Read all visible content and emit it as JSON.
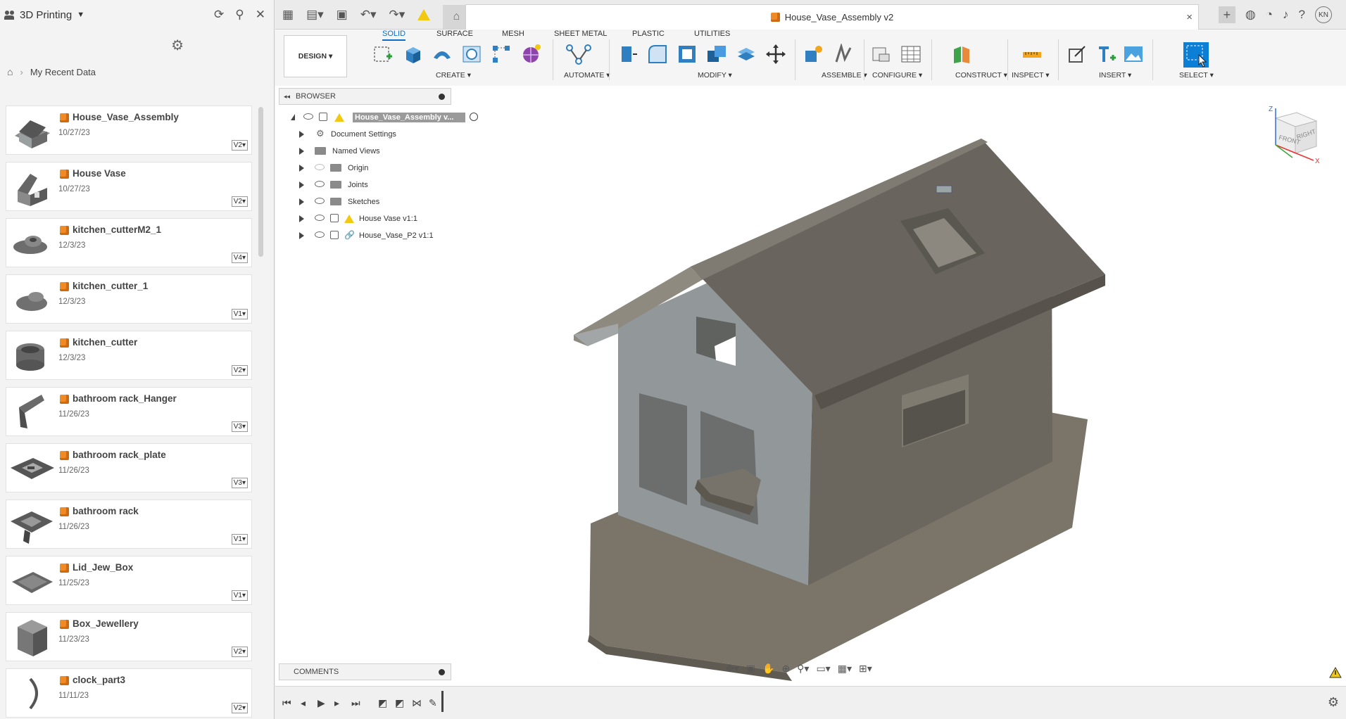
{
  "left_panel": {
    "project_title": "3D Printing",
    "breadcrumb": "My Recent Data",
    "files": [
      {
        "name": "House_Vase_Assembly",
        "date": "10/27/23",
        "version": "V2▾"
      },
      {
        "name": "House Vase",
        "date": "10/27/23",
        "version": "V2▾"
      },
      {
        "name": "kitchen_cutterM2_1",
        "date": "12/3/23",
        "version": "V4▾"
      },
      {
        "name": "kitchen_cutter_1",
        "date": "12/3/23",
        "version": "V1▾"
      },
      {
        "name": "kitchen_cutter",
        "date": "12/3/23",
        "version": "V2▾"
      },
      {
        "name": "bathroom rack_Hanger",
        "date": "11/26/23",
        "version": "V3▾"
      },
      {
        "name": "bathroom rack_plate",
        "date": "11/26/23",
        "version": "V3▾"
      },
      {
        "name": "bathroom rack",
        "date": "11/26/23",
        "version": "V1▾"
      },
      {
        "name": "Lid_Jew_Box",
        "date": "11/25/23",
        "version": "V1▾"
      },
      {
        "name": "Box_Jewellery",
        "date": "11/23/23",
        "version": "V2▾"
      },
      {
        "name": "clock_part3",
        "date": "11/11/23",
        "version": "V2▾"
      }
    ]
  },
  "titlebar": {
    "document_title": "House_Vase_Assembly v2",
    "close": "×",
    "user_initials": "KN"
  },
  "toolbar": {
    "design_label": "DESIGN ▾",
    "tabs": [
      "SOLID",
      "SURFACE",
      "MESH",
      "SHEET METAL",
      "PLASTIC",
      "UTILITIES"
    ],
    "groups": [
      "CREATE ▾",
      "AUTOMATE ▾",
      "MODIFY ▾",
      "ASSEMBLE ▾",
      "CONFIGURE ▾",
      "CONSTRUCT ▾",
      "INSPECT ▾",
      "INSERT ▾",
      "SELECT ▾"
    ]
  },
  "browser": {
    "title": "BROWSER",
    "root": "House_Vase_Assembly v...",
    "nodes": [
      "Document Settings",
      "Named Views",
      "Origin",
      "Joints",
      "Sketches",
      "House Vase v1:1",
      "House_Vase_P2 v1:1"
    ]
  },
  "comments": {
    "title": "COMMENTS"
  },
  "viewcube": {
    "front": "FRONT",
    "right": "RIGHT",
    "z": "Z",
    "x": "X"
  },
  "colors": {
    "accent": "#0b6fc7",
    "warning": "#f2c811",
    "file_icon": "#f08a24",
    "model_wall": "#6e6a62",
    "model_front": "#8f9596"
  }
}
